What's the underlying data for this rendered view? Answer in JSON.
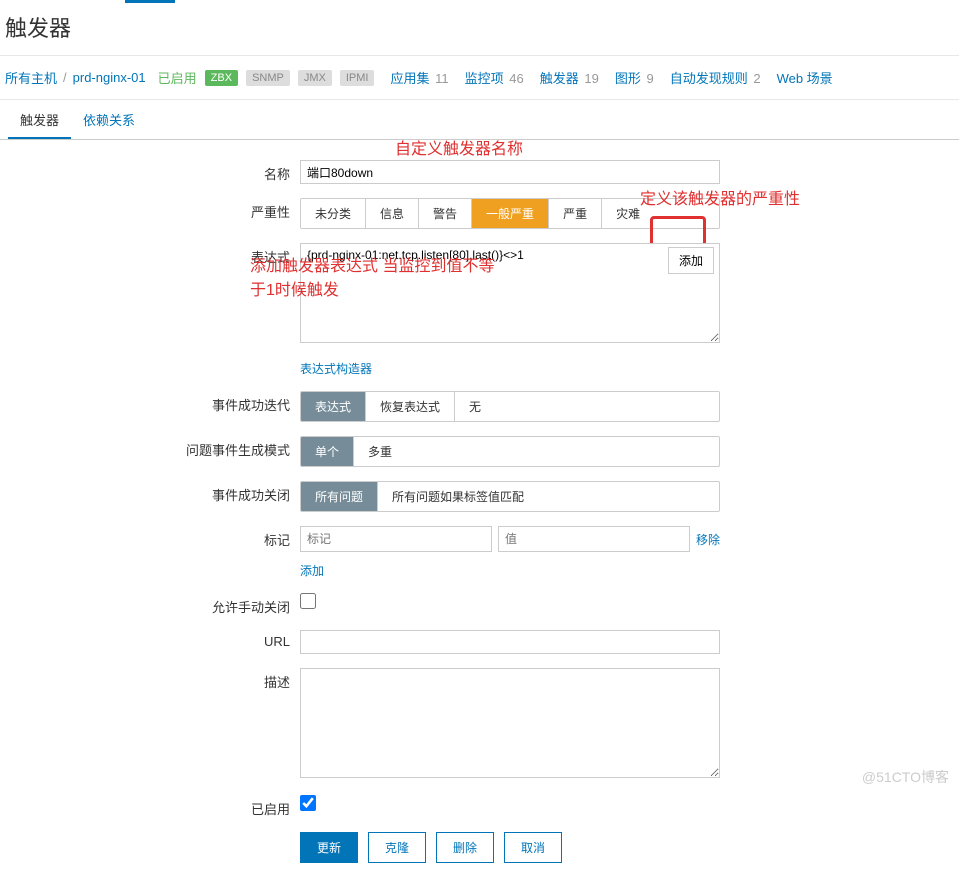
{
  "page": {
    "title": "触发器"
  },
  "breadcrumb": {
    "all_hosts": "所有主机",
    "host": "prd-nginx-01",
    "enabled": "已启用",
    "badges": {
      "zbx": "ZBX",
      "snmp": "SNMP",
      "jmx": "JMX",
      "ipmi": "IPMI"
    },
    "items": {
      "apps": {
        "label": "应用集",
        "count": "11"
      },
      "monitors": {
        "label": "监控项",
        "count": "46"
      },
      "triggers": {
        "label": "触发器",
        "count": "19"
      },
      "graphs": {
        "label": "图形",
        "count": "9"
      },
      "discovery": {
        "label": "自动发现规则",
        "count": "2"
      },
      "web": {
        "label": "Web 场景",
        "count": ""
      }
    }
  },
  "tabs": {
    "trigger": "触发器",
    "deps": "依赖关系"
  },
  "labels": {
    "name": "名称",
    "severity": "严重性",
    "expression": "表达式",
    "expr_builder": "表达式构造器",
    "event_ok_iter": "事件成功迭代",
    "problem_gen_mode": "问题事件生成模式",
    "event_ok_close": "事件成功关闭",
    "tags": "标记",
    "allow_manual_close": "允许手动关闭",
    "url": "URL",
    "description": "描述",
    "enabled": "已启用"
  },
  "values": {
    "name": "端口80down",
    "expression": "{prd-nginx-01:net.tcp.listen[80].last()}<>1",
    "url": "",
    "description": ""
  },
  "severity_opts": {
    "unclassified": "未分类",
    "info": "信息",
    "warning": "警告",
    "average": "一般严重",
    "high": "严重",
    "disaster": "灾难"
  },
  "event_ok_iter_opts": {
    "expression": "表达式",
    "recovery": "恢复表达式",
    "none": "无"
  },
  "problem_gen_opts": {
    "single": "单个",
    "multiple": "多重"
  },
  "event_ok_close_opts": {
    "all": "所有问题",
    "tag_match": "所有问题如果标签值匹配"
  },
  "tags": {
    "placeholder_tag": "标记",
    "placeholder_value": "值",
    "remove": "移除",
    "add": "添加"
  },
  "buttons": {
    "add_expr": "添加",
    "update": "更新",
    "clone": "克隆",
    "delete": "删除",
    "cancel": "取消"
  },
  "annotations": {
    "custom_name": "自定义触发器名称",
    "define_severity": "定义该触发器的严重性",
    "expr_note_l1": "添加触发器表达式 当监控到值不等",
    "expr_note_l2": "于1时候触发"
  },
  "watermark": "@51CTO博客"
}
